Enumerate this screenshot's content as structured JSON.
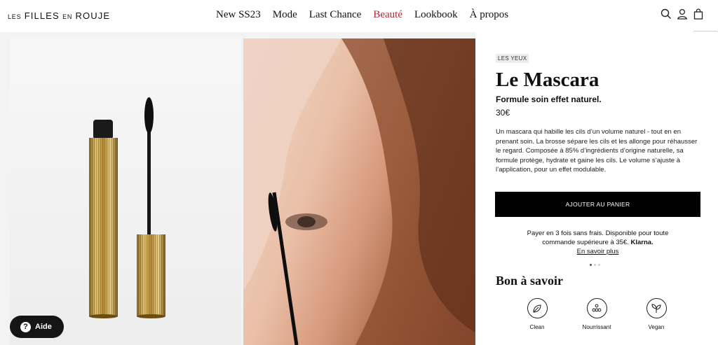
{
  "header": {
    "logo": {
      "part1": "LES",
      "part2": "FILLES",
      "part3": "EN",
      "part4": "ROUJE"
    },
    "nav": [
      {
        "label": "New SS23",
        "active": false
      },
      {
        "label": "Mode",
        "active": false
      },
      {
        "label": "Last Chance",
        "active": false
      },
      {
        "label": "Beauté",
        "active": true
      },
      {
        "label": "Lookbook",
        "active": false
      },
      {
        "label": "À propos",
        "active": false
      }
    ],
    "icons": [
      "search-icon",
      "account-icon",
      "bag-icon"
    ],
    "active_color": "#b3263a"
  },
  "product": {
    "tag": "LES YEUX",
    "title": "Le Mascara",
    "subtitle": "Formule soin effet naturel.",
    "price": "30€",
    "description": "Un mascara qui habille les cils d’un volume naturel - tout en en prenant soin. La brosse sépare les cils et les allonge pour réhausser le regard. Composée à 85% d’ingrédients d’origine naturelle, sa formule protège, hydrate et gaine les cils. Le volume s’ajuste à l’application, pour un effet modulable.",
    "add_to_cart": "AJOUTER AU PANIER",
    "klarna": {
      "line1": "Payer en 3 fois sans frais. Disponible pour toute",
      "line2_prefix": "commande supérieure à 35€.",
      "line2_brand": "Klarna.",
      "link": "En savoir plus"
    },
    "carousel": {
      "count": 3,
      "active_index": 0
    },
    "good_to_know": {
      "title": "Bon à savoir",
      "features": [
        {
          "label": "Clean",
          "icon": "leaf-icon"
        },
        {
          "label": "Nourrissant",
          "icon": "dots-icon"
        },
        {
          "label": "Vegan",
          "icon": "plant-icon"
        }
      ]
    }
  },
  "help": {
    "label": "Aide",
    "icon": "question-icon"
  }
}
